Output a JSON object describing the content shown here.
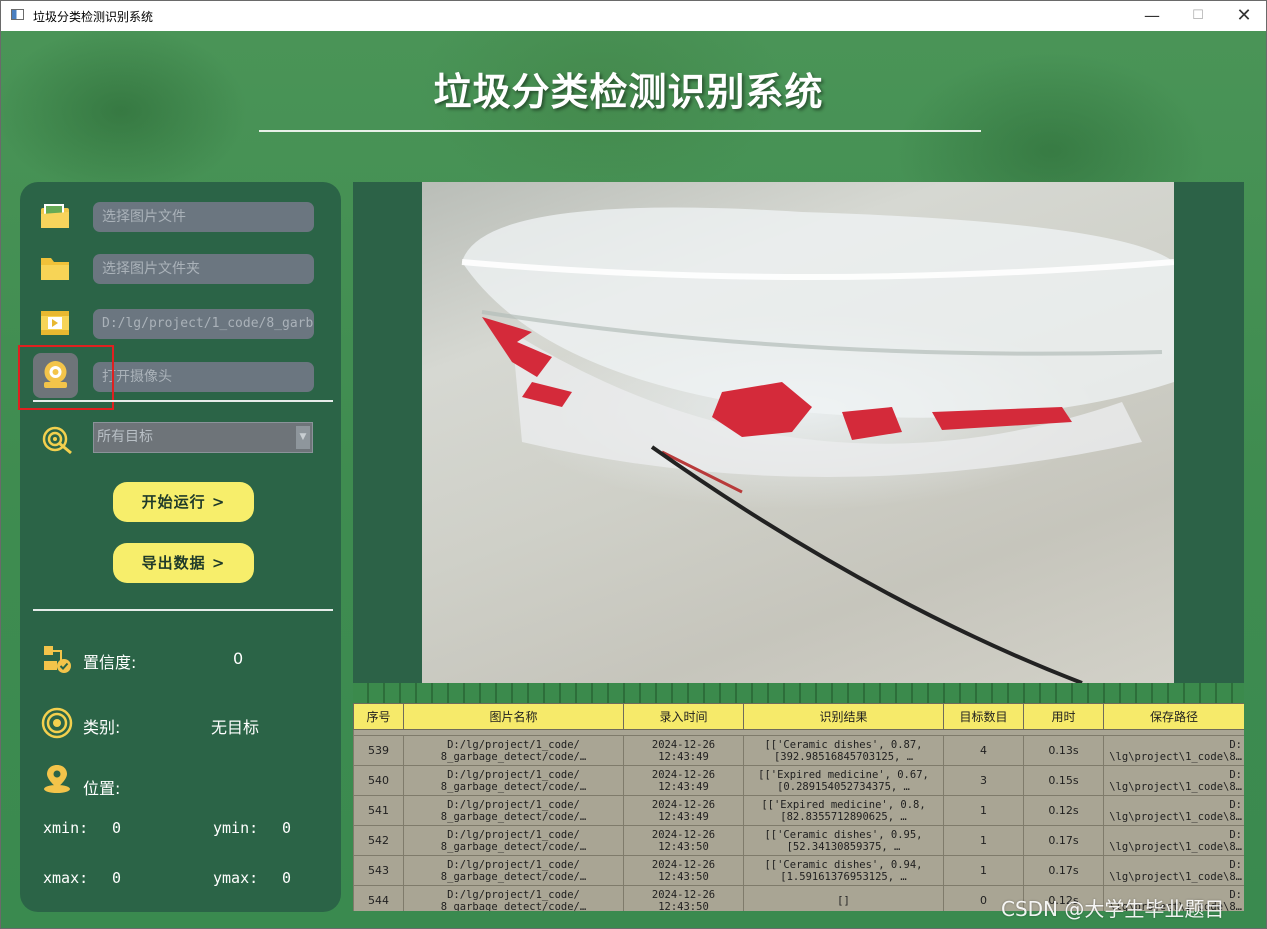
{
  "window": {
    "title": "垃圾分类检测识别系统"
  },
  "app": {
    "title": "垃圾分类检测识别系统"
  },
  "sidebar": {
    "image_file_placeholder": "选择图片文件",
    "image_folder_placeholder": "选择图片文件夹",
    "video_path": "D:/lg/project/1_code/8_garb",
    "camera_placeholder": "打开摄像头",
    "target_select": "所有目标",
    "start_button": "开始运行 >",
    "export_button": "导出数据 >",
    "confidence_label": "置信度:",
    "confidence_value": "0",
    "class_label": "类别:",
    "class_value": "无目标",
    "position_label": "位置:",
    "xmin_label": "xmin:",
    "xmin_value": "0",
    "ymin_label": "ymin:",
    "ymin_value": "0",
    "xmax_label": "xmax:",
    "xmax_value": "0",
    "ymax_label": "ymax:",
    "ymax_value": "0"
  },
  "table": {
    "headers": [
      "序号",
      "图片名称",
      "录入时间",
      "识别结果",
      "目标数目",
      "用时",
      "保存路径"
    ],
    "rows": [
      {
        "id": "539",
        "name1": "D:/lg/project/1_code/",
        "name2": "8_garbage_detect/code/…",
        "date": "2024-12-26",
        "time": "12:43:49",
        "res1": "[['Ceramic dishes', 0.87,",
        "res2": "[392.98516845703125, …",
        "count": "4",
        "dur": "0.13s",
        "path1": "D:",
        "path2": "\\lg\\project\\1_code\\8…"
      },
      {
        "id": "540",
        "name1": "D:/lg/project/1_code/",
        "name2": "8_garbage_detect/code/…",
        "date": "2024-12-26",
        "time": "12:43:49",
        "res1": "[['Expired medicine', 0.67,",
        "res2": "[0.289154052734375, …",
        "count": "3",
        "dur": "0.15s",
        "path1": "D:",
        "path2": "\\lg\\project\\1_code\\8…"
      },
      {
        "id": "541",
        "name1": "D:/lg/project/1_code/",
        "name2": "8_garbage_detect/code/…",
        "date": "2024-12-26",
        "time": "12:43:49",
        "res1": "[['Expired medicine', 0.8,",
        "res2": "[82.8355712890625, …",
        "count": "1",
        "dur": "0.12s",
        "path1": "D:",
        "path2": "\\lg\\project\\1_code\\8…"
      },
      {
        "id": "542",
        "name1": "D:/lg/project/1_code/",
        "name2": "8_garbage_detect/code/…",
        "date": "2024-12-26",
        "time": "12:43:50",
        "res1": "[['Ceramic dishes', 0.95,",
        "res2": "[52.34130859375, …",
        "count": "1",
        "dur": "0.17s",
        "path1": "D:",
        "path2": "\\lg\\project\\1_code\\8…"
      },
      {
        "id": "543",
        "name1": "D:/lg/project/1_code/",
        "name2": "8_garbage_detect/code/…",
        "date": "2024-12-26",
        "time": "12:43:50",
        "res1": "[['Ceramic dishes', 0.94,",
        "res2": "[1.59161376953125, …",
        "count": "1",
        "dur": "0.17s",
        "path1": "D:",
        "path2": "\\lg\\project\\1_code\\8…"
      },
      {
        "id": "544",
        "name1": "D:/lg/project/1_code/",
        "name2": "8_garbage_detect/code/…",
        "date": "2024-12-26",
        "time": "12:43:50",
        "res1": "[]",
        "res2": "",
        "count": "0",
        "dur": "0.12s",
        "path1": "D:",
        "path2": "\\lg\\project\\1_code\\8…"
      }
    ]
  },
  "watermark": "CSDN @大学生毕业题目",
  "icons": {
    "image_file": "image-file-icon",
    "folder": "folder-icon",
    "video": "video-file-icon",
    "camera": "webcam-icon",
    "target": "target-icon",
    "confidence": "confidence-icon",
    "class": "class-icon",
    "position": "location-pin-icon"
  },
  "colors": {
    "panel": "#2b6447",
    "accent_yellow": "#f7ee6b",
    "field": "#6b7680",
    "highlight": "#e02020"
  }
}
